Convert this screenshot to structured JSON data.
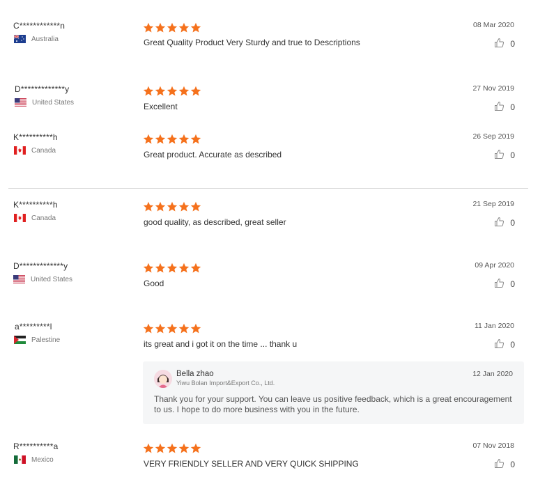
{
  "reviews": [
    {
      "user": "C************n",
      "country": "Australia",
      "flag": "au",
      "text": "Great Quality Product Very Sturdy and true to Descriptions",
      "date": "08 Mar 2020",
      "likes": "0"
    },
    {
      "user": "D*************y",
      "country": "United States",
      "flag": "us",
      "text": "Excellent",
      "date": "27 Nov 2019",
      "likes": "0"
    },
    {
      "user": "K**********h",
      "country": "Canada",
      "flag": "ca",
      "text": "Great product. Accurate as described",
      "date": "26 Sep 2019",
      "likes": "0"
    },
    {
      "user": "K**********h",
      "country": "Canada",
      "flag": "ca",
      "text": "good quality, as described, great seller",
      "date": "21 Sep 2019",
      "likes": "0"
    },
    {
      "user": "D*************y",
      "country": "United States",
      "flag": "us",
      "text": "Good",
      "date": "09 Apr 2020",
      "likes": "0"
    },
    {
      "user": "a*********l",
      "country": "Palestine",
      "flag": "ps",
      "text": "its great and i got it on the time ... thank u",
      "date": "11 Jan 2020",
      "likes": "0"
    },
    {
      "user": "R**********a",
      "country": "Mexico",
      "flag": "mx",
      "text": "VERY FRIENDLY SELLER AND VERY QUICK SHIPPING",
      "date": "07 Nov 2018",
      "likes": "0"
    }
  ],
  "rating_stars": 5,
  "star_color": "#f5711c",
  "reply": {
    "name": "Bella zhao",
    "company": "Yiwu Bolan Import&Export Co., Ltd.",
    "date": "12 Jan 2020",
    "text": "Thank you for your support. You can leave us positive feedback, which is a great encouragement to us. I hope to do more business with you in the future."
  },
  "icons": {
    "like": "thumbs-up-icon",
    "star": "star-icon",
    "avatar": "seller-avatar-icon"
  }
}
